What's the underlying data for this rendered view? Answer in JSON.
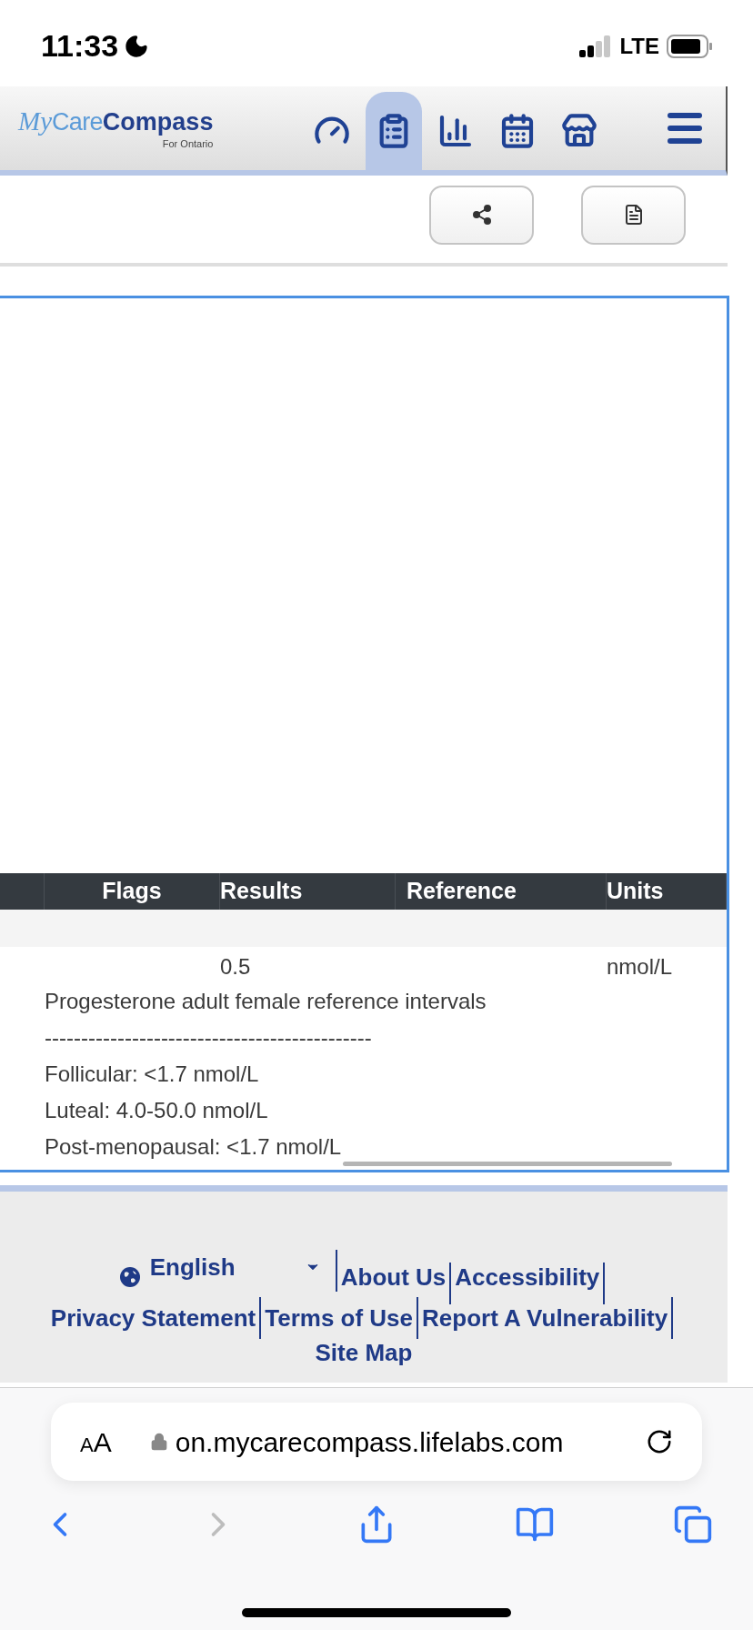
{
  "status_bar": {
    "time": "11:33",
    "network": "LTE"
  },
  "header": {
    "logo_italic": "My",
    "logo": "Care",
    "logo_bold": "Compass",
    "logo_subtitle": "For Ontario",
    "nav": [
      {
        "kind": "dashboard",
        "selected": false
      },
      {
        "kind": "results",
        "selected": true
      },
      {
        "kind": "charts",
        "selected": false
      },
      {
        "kind": "calendar",
        "selected": false
      },
      {
        "kind": "store",
        "selected": false
      }
    ]
  },
  "actions": [
    {
      "kind": "share"
    },
    {
      "kind": "pdf"
    }
  ],
  "table": {
    "columns": [
      "Flags",
      "Results",
      "Reference",
      "Units"
    ],
    "rows": [
      {
        "result": "0.5",
        "units": "nmol/L",
        "notes": [
          "Progesterone adult female reference intervals",
          "---------------------------------------------",
          "Follicular: <1.7 nmol/L",
          "Luteal: 4.0-50.0 nmol/L",
          "Post-menopausal: <1.7 nmol/L"
        ]
      }
    ]
  },
  "footer": {
    "language": "English",
    "links_row_1": [
      "About Us",
      "Accessibility"
    ],
    "links_row_2": [
      "Privacy Statement",
      "Terms of Use",
      "Report A Vulnerability"
    ],
    "links_row_3": [
      "Site Map"
    ]
  },
  "browser": {
    "text_size": "AA",
    "url": "on.mycarecompass.lifelabs.com"
  }
}
